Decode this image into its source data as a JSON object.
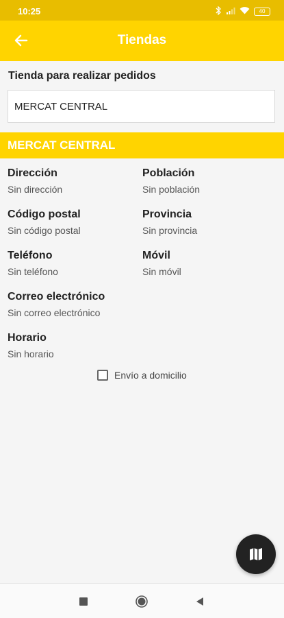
{
  "status_bar": {
    "time": "10:25",
    "icons": [
      "bluetooth-icon",
      "signal-icon",
      "wifi-icon",
      "battery-icon"
    ],
    "battery_level": "40"
  },
  "app_bar": {
    "title": "Tiendas",
    "back_icon": "arrow-left-icon",
    "color": "#ffd400"
  },
  "store_select": {
    "label": "Tienda para realizar pedidos",
    "value": "MERCAT CENTRAL"
  },
  "store": {
    "name": "MERCAT CENTRAL",
    "fields": {
      "direccion": {
        "label": "Dirección",
        "value": "Sin dirección"
      },
      "poblacion": {
        "label": "Población",
        "value": "Sin población"
      },
      "codigo_postal": {
        "label": "Código postal",
        "value": "Sin código postal"
      },
      "provincia": {
        "label": "Provincia",
        "value": "Sin provincia"
      },
      "telefono": {
        "label": "Teléfono",
        "value": "Sin teléfono"
      },
      "movil": {
        "label": "Móvil",
        "value": "Sin móvil"
      },
      "correo": {
        "label": "Correo electrónico",
        "value": "Sin correo electrónico"
      },
      "horario": {
        "label": "Horario",
        "value": "Sin horario"
      }
    },
    "home_delivery": {
      "label": "Envío a domicilio",
      "checked": false
    }
  },
  "fab": {
    "icon": "map-icon"
  },
  "nav_bar": {
    "icons": [
      "recents-square-icon",
      "home-circle-icon",
      "back-triangle-icon"
    ]
  }
}
